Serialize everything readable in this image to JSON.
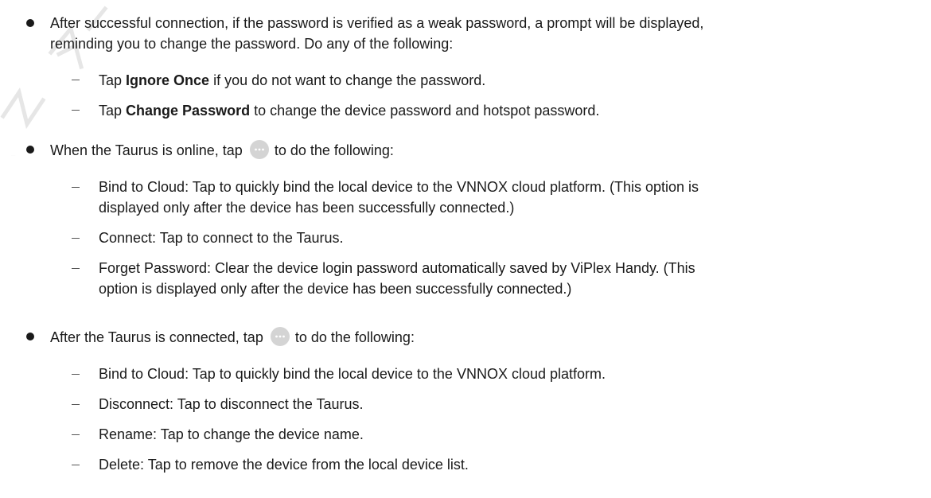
{
  "watermark": {
    "text": "NOVASTAR"
  },
  "items": [
    {
      "line1": "After successful connection, if the password is verified as a weak password, a prompt will be displayed,",
      "line2": "reminding you to change the password. Do any of the following:",
      "subs": [
        {
          "pre": "Tap ",
          "bold": "Ignore Once",
          "post": " if you do not want to change the password."
        },
        {
          "pre": "Tap ",
          "bold": "Change Password",
          "post": " to change the device password and hotspot password."
        }
      ]
    },
    {
      "pre_icon": "When the Taurus is online, tap",
      "post_icon": "to do the following:",
      "icon": "more-icon",
      "subs": [
        {
          "line1": "Bind to Cloud: Tap to quickly bind the local device to the VNNOX cloud platform. (This option is",
          "line2": "displayed only after the device has been successfully connected.)"
        },
        {
          "line1": "Connect: Tap to connect to the Taurus."
        },
        {
          "line1": "Forget Password: Clear the device login password automatically saved by ViPlex Handy. (This",
          "line2": "option is displayed only after the device has been successfully connected.)"
        }
      ]
    },
    {
      "pre_icon": "After the Taurus is connected, tap",
      "post_icon": "to do the following:",
      "icon": "more-icon",
      "subs": [
        {
          "line1": "Bind to Cloud: Tap to quickly bind the local device to the VNNOX cloud platform."
        },
        {
          "line1": "Disconnect: Tap to disconnect the Taurus."
        },
        {
          "line1": "Rename: Tap to change the device name."
        },
        {
          "line1": "Delete: Tap to remove the device from the local device list."
        }
      ]
    }
  ]
}
